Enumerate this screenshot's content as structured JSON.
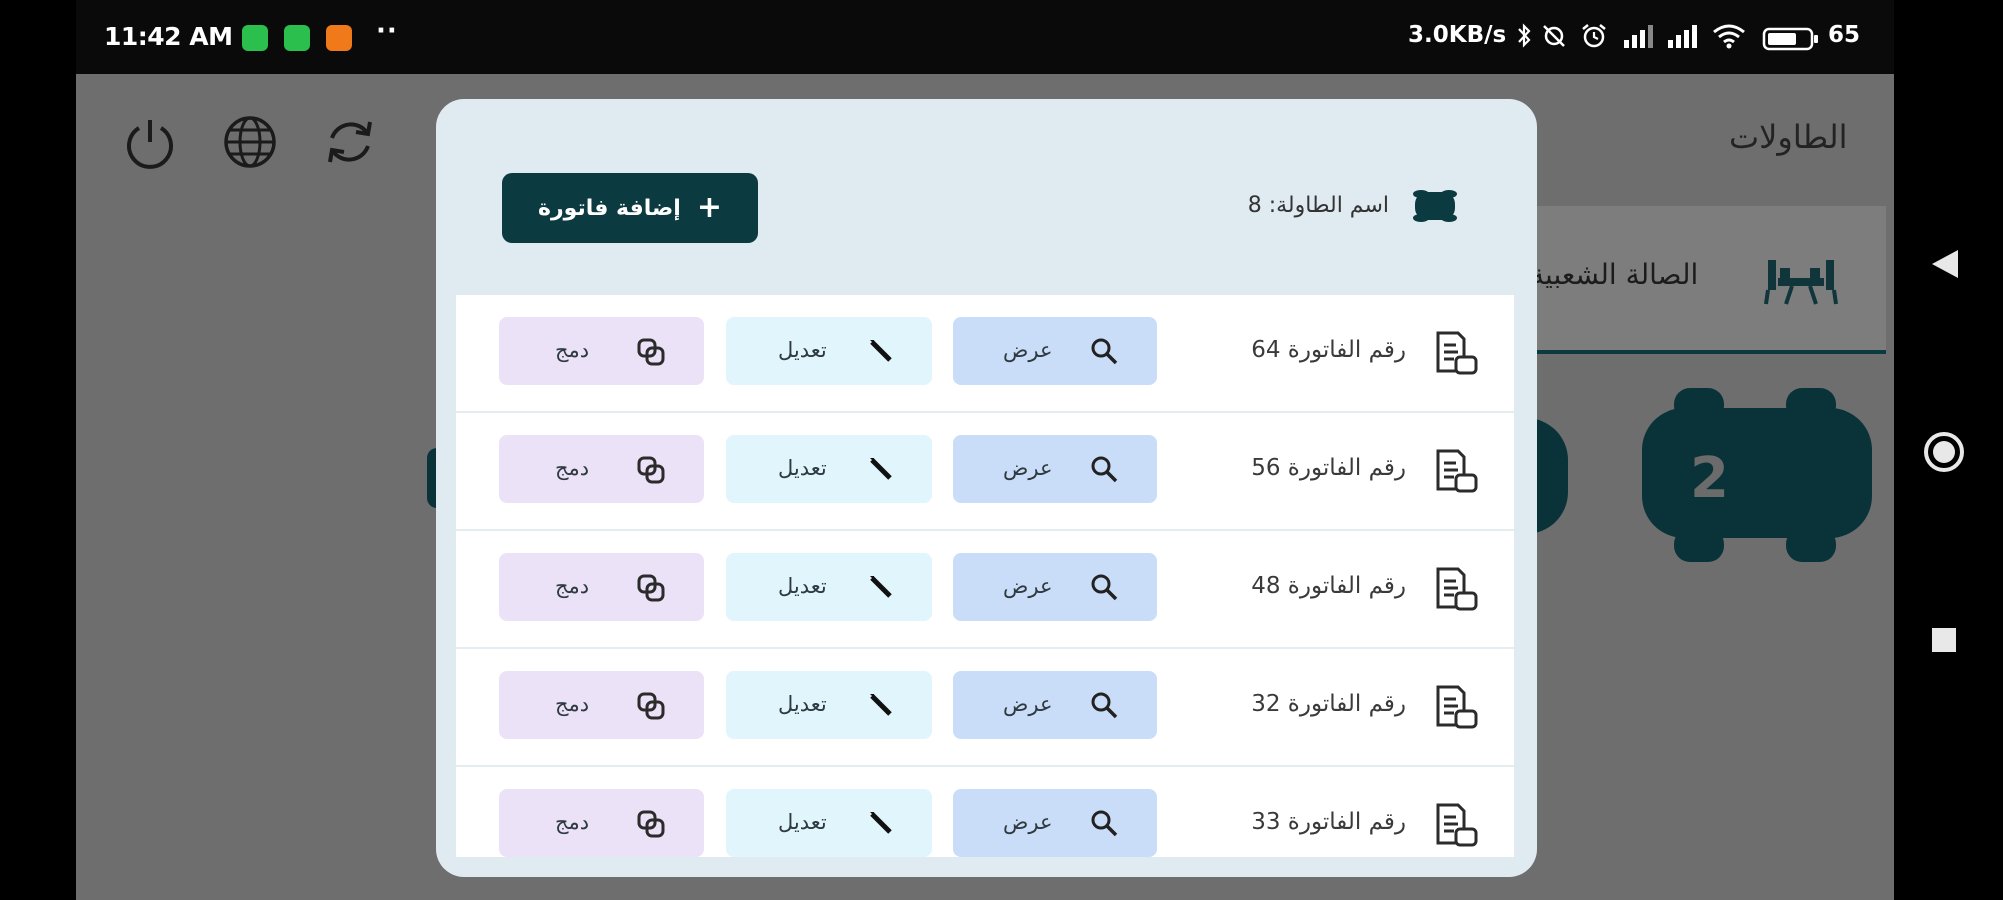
{
  "status_bar": {
    "time": "11:42 AM",
    "overflow_dots": "··",
    "network_speed": "3.0KB/s",
    "battery": "65"
  },
  "background": {
    "title": "الطاولات",
    "hall_tab_label": "الصالة الشعبية",
    "table_number": "2"
  },
  "modal": {
    "add_invoice_label": "إضافة فاتورة",
    "table_name_text": "اسم الطاولة: 8",
    "invoices": [
      {
        "label": "رقم الفاتورة 64",
        "view": "عرض",
        "edit": "تعديل",
        "merge": "دمج"
      },
      {
        "label": "رقم الفاتورة 56",
        "view": "عرض",
        "edit": "تعديل",
        "merge": "دمج"
      },
      {
        "label": "رقم الفاتورة 48",
        "view": "عرض",
        "edit": "تعديل",
        "merge": "دمج"
      },
      {
        "label": "رقم الفاتورة 32",
        "view": "عرض",
        "edit": "تعديل",
        "merge": "دمج"
      },
      {
        "label": "رقم الفاتورة 33",
        "view": "عرض",
        "edit": "تعديل",
        "merge": "دمج"
      }
    ]
  },
  "colors": {
    "primary": "#0b3a40",
    "view_bg": "#c9dcf8",
    "edit_bg": "#e0f5fc",
    "merge_bg": "#ece2f8",
    "modal_bg": "#dfebf0"
  }
}
